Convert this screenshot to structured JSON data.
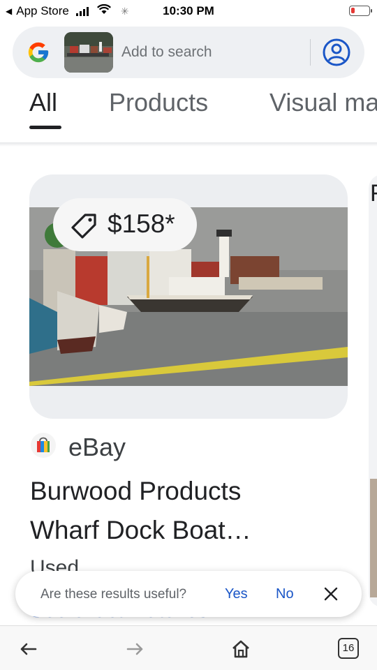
{
  "status_bar": {
    "back_app": "App Store",
    "time": "10:30 PM",
    "battery_color": "#e53935"
  },
  "search": {
    "placeholder": "Add to search",
    "logo_icon": "google-g-icon",
    "account_icon": "account-circle-icon"
  },
  "tabs": [
    {
      "label": "All",
      "active": true
    },
    {
      "label": "Products",
      "active": false
    },
    {
      "label": "Visual ma",
      "active": false
    }
  ],
  "result": {
    "price": "$158*",
    "price_icon": "price-tag-icon",
    "store": "eBay",
    "title_line1": "Burwood Products",
    "title_line2": "Wharf Dock Boat…",
    "condition": "Used",
    "see_exact": "See exact matches"
  },
  "next_card": {
    "letter": "F"
  },
  "feedback": {
    "question": "Are these results useful?",
    "yes": "Yes",
    "no": "No"
  },
  "bottom_bar": {
    "tab_count": "16"
  },
  "colors": {
    "accent_blue": "#1a56c7",
    "search_bg": "#eef0f3",
    "text_primary": "#202124"
  }
}
